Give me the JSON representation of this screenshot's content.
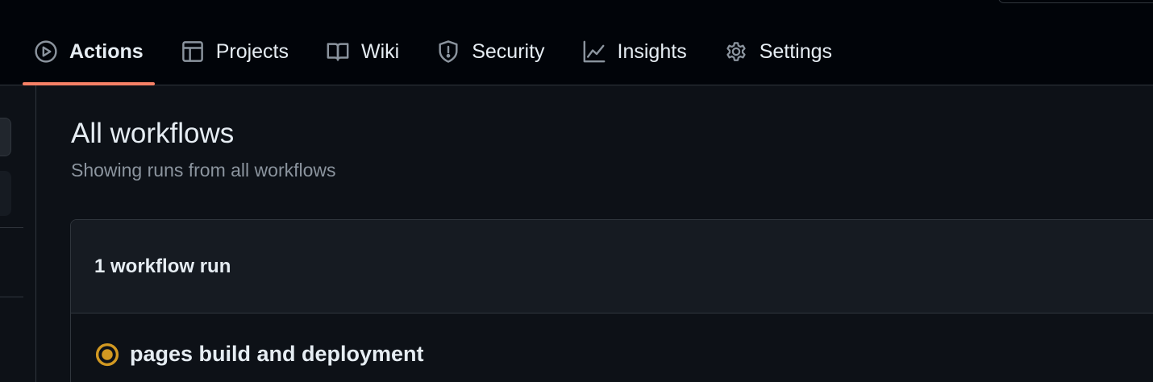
{
  "repo_nav": {
    "tabs": [
      {
        "label": "Actions",
        "icon": "play-icon",
        "active": true
      },
      {
        "label": "Projects",
        "icon": "table-icon",
        "active": false
      },
      {
        "label": "Wiki",
        "icon": "book-icon",
        "active": false
      },
      {
        "label": "Security",
        "icon": "shield-icon",
        "active": false
      },
      {
        "label": "Insights",
        "icon": "graph-icon",
        "active": false
      },
      {
        "label": "Settings",
        "icon": "gear-icon",
        "active": false
      }
    ]
  },
  "main": {
    "title": "All workflows",
    "subtitle": "Showing runs from all workflows",
    "runs_count_label": "1 workflow run",
    "runs": [
      {
        "title": "pages build and deployment",
        "status": "in-progress",
        "status_color": "#d29922"
      }
    ]
  },
  "colors": {
    "accent_underline": "#f78166",
    "background": "#0d1117",
    "header_background": "#010409"
  }
}
